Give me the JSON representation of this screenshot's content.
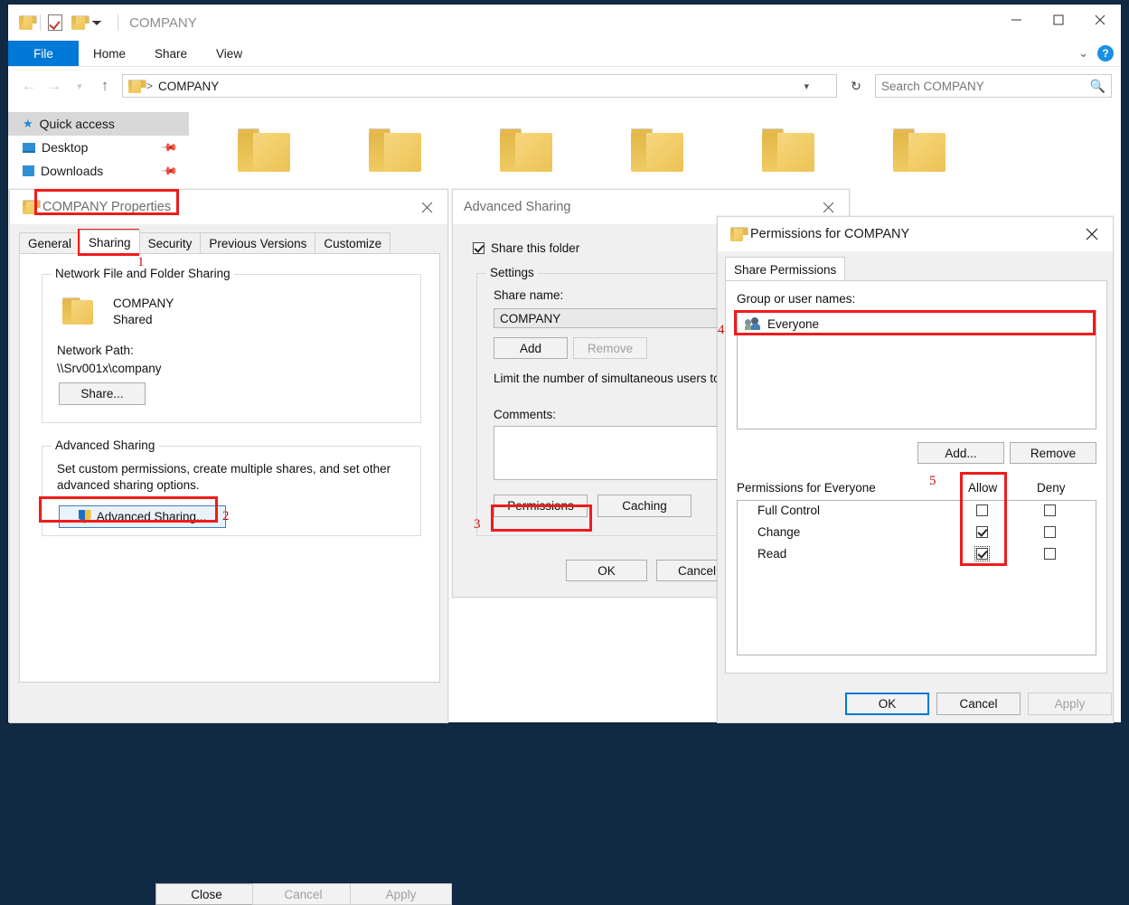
{
  "explorer": {
    "title": "COMPANY",
    "quick_access_icon": "checkmark-document-icon",
    "ribbon_tabs": [
      "File",
      "Home",
      "Share",
      "View"
    ],
    "window_controls": {
      "minimize": "minimize-icon",
      "maximize": "maximize-icon",
      "close": "close-icon"
    },
    "help_label": "?",
    "address": {
      "crumb_separator": ">",
      "path": "COMPANY",
      "refresh": "refresh-icon"
    },
    "search": {
      "placeholder": "Search COMPANY",
      "icon": "search-icon"
    },
    "nav_pane": [
      {
        "label": "Quick access",
        "icon": "star-icon",
        "selected": true,
        "pinned": false
      },
      {
        "label": "Desktop",
        "icon": "desktop-icon",
        "selected": false,
        "pinned": true
      },
      {
        "label": "Downloads",
        "icon": "downloads-icon",
        "selected": false,
        "pinned": true
      }
    ],
    "folder_count": 6
  },
  "properties_dialog": {
    "title": "COMPANY Properties",
    "folder_icon": "folder-icon",
    "close_icon": "close-icon",
    "tabs": [
      {
        "label": "General",
        "active": false
      },
      {
        "label": "Sharing",
        "active": true
      },
      {
        "label": "Security",
        "active": false
      },
      {
        "label": "Previous Versions",
        "active": false
      },
      {
        "label": "Customize",
        "active": false
      }
    ],
    "network_group": {
      "legend": "Network File and Folder Sharing",
      "share_name": "COMPANY",
      "share_status": "Shared",
      "network_path_label": "Network Path:",
      "network_path_value": "\\\\Srv001x\\company",
      "share_button": "Share..."
    },
    "advanced_group": {
      "legend": "Advanced Sharing",
      "description": "Set custom permissions, create multiple shares, and set other advanced sharing options.",
      "button": "Advanced Sharing...",
      "button_icon": "shield-icon"
    },
    "buttons": [
      {
        "label": "Close",
        "disabled": false
      },
      {
        "label": "Cancel",
        "disabled": true
      },
      {
        "label": "Apply",
        "disabled": true
      }
    ]
  },
  "advanced_sharing_dialog": {
    "title": "Advanced Sharing",
    "close_icon": "close-icon",
    "share_this_folder": {
      "label": "Share this folder",
      "checked": true
    },
    "settings_legend": "Settings",
    "share_name_label": "Share name:",
    "share_name_value": "COMPANY",
    "add_button": "Add",
    "remove_button": "Remove",
    "limit_label": "Limit the number of simultaneous users to",
    "comments_label": "Comments:",
    "comments_value": "",
    "permissions_button": "Permissions",
    "caching_button": "Caching",
    "ok_button": "OK",
    "cancel_button": "Cancel"
  },
  "permissions_dialog": {
    "title": "Permissions for COMPANY",
    "folder_icon": "folder-icon",
    "close_icon": "close-icon",
    "tabs": [
      {
        "label": "Share Permissions",
        "active": true
      }
    ],
    "group_label": "Group or user names:",
    "group_entries": [
      {
        "name": "Everyone",
        "icon": "users-group-icon",
        "selected": true
      }
    ],
    "add_button": "Add...",
    "remove_button": "Remove",
    "permissions_label": "Permissions for Everyone",
    "col_allow": "Allow",
    "col_deny": "Deny",
    "permission_rows": [
      {
        "name": "Full Control",
        "allow": false,
        "deny": false,
        "focus": false
      },
      {
        "name": "Change",
        "allow": true,
        "deny": false,
        "focus": false
      },
      {
        "name": "Read",
        "allow": true,
        "deny": false,
        "focus": true
      }
    ],
    "buttons": [
      {
        "label": "OK",
        "default": true,
        "disabled": false
      },
      {
        "label": "Cancel",
        "default": false,
        "disabled": false
      },
      {
        "label": "Apply",
        "default": false,
        "disabled": true
      }
    ]
  },
  "annotations": {
    "color": "#ee1c1c",
    "steps": [
      {
        "number": "1",
        "target": "sharing-tab"
      },
      {
        "number": "2",
        "target": "advanced-sharing-button"
      },
      {
        "number": "3",
        "target": "permissions-button"
      },
      {
        "number": "4",
        "target": "everyone-entry"
      },
      {
        "number": "5",
        "target": "allow-column"
      }
    ]
  }
}
